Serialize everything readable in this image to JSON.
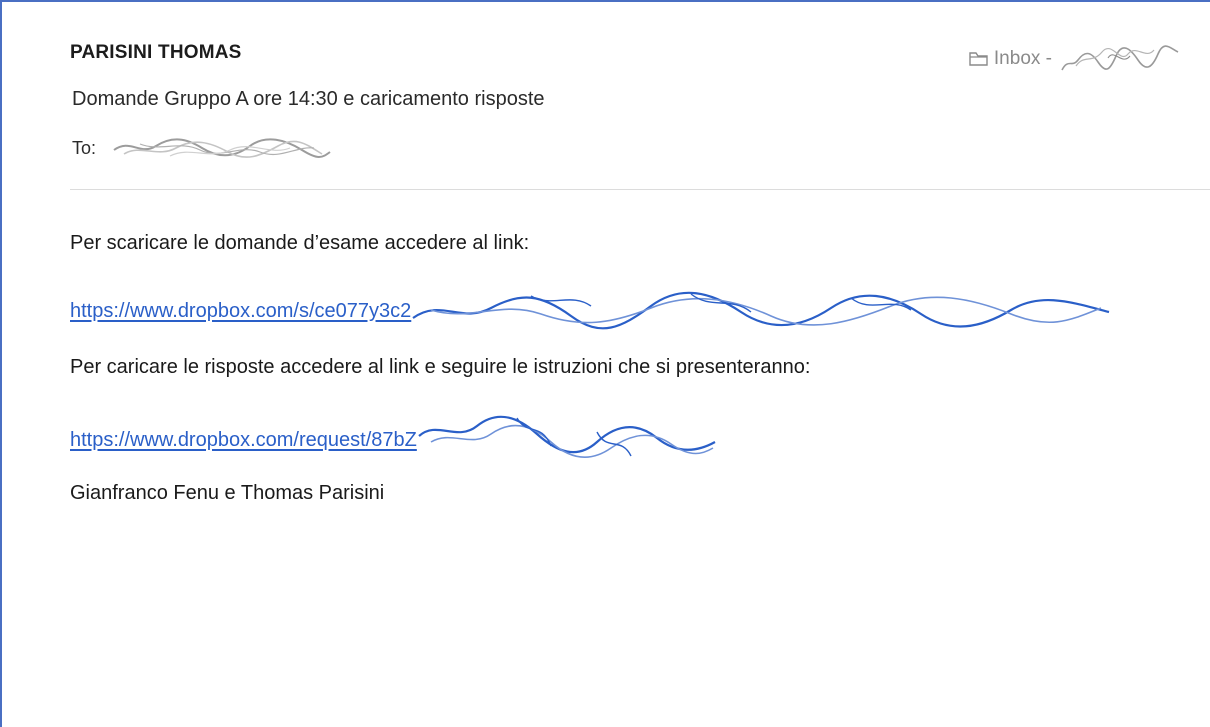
{
  "email": {
    "sender": "PARISINI THOMAS",
    "subject": "Domande Gruppo A ore 14:30 e caricamento risposte",
    "to_label": "To:",
    "mailbox_label": "Inbox -"
  },
  "body": {
    "line1": "Per scaricare le domande d’esame accedere al link:",
    "link1": "https://www.dropbox.com/s/ce077y3c2",
    "line2": "Per caricare le risposte accedere al link e seguire le istruzioni che si presenteranno:",
    "link2": "https://www.dropbox.com/request/87bZ",
    "signature": "Gianfranco Fenu e Thomas Parisini"
  },
  "colors": {
    "link": "#2a5fc8",
    "frame": "#4a6fc3",
    "divider": "#dcdcdc"
  },
  "icons": [
    "folder-icon"
  ]
}
